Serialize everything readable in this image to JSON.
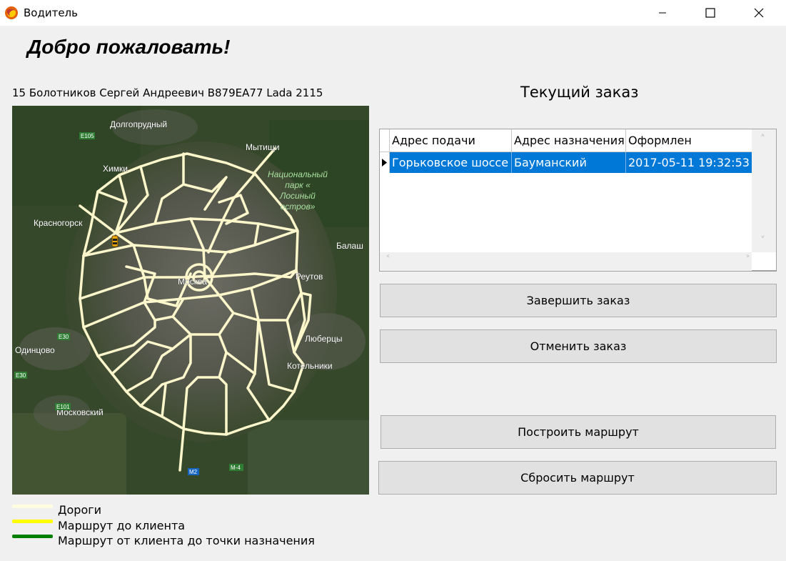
{
  "window": {
    "title": "Водитель"
  },
  "header": {
    "welcome": "Добро пожаловать!",
    "driver_info": "15 Болотников Сергей Андреевич В879ЕА77 Lada 2115"
  },
  "map": {
    "labels": {
      "dolgoprudny": "Долгопрудный",
      "mytishchi": "Мытищи",
      "khimki": "Химки",
      "park": [
        "Национальный",
        "парк «",
        "Лосиный",
        "остров»"
      ],
      "krasnogorsk": "Красногорск",
      "balash": "Балаш",
      "reutov": "Реутов",
      "moscow": "Москва",
      "lyubertsy": "Люберцы",
      "odintsovo": "Одинцово",
      "kotelniki": "Котельники",
      "moskovsky": "Московский",
      "e105": "E105",
      "e30a": "E30",
      "e30b": "E30",
      "e101": "E101",
      "m2": "M2",
      "m4": "M-4"
    }
  },
  "order": {
    "title": "Текущий заказ",
    "columns": [
      "Адрес подачи",
      "Адрес назначения",
      "Оформлен"
    ],
    "rows": [
      [
        "Горьковское шоссе",
        "Бауманский",
        "2017-05-11 19:32:53"
      ]
    ]
  },
  "buttons": {
    "finish": "Завершить заказ",
    "cancel": "Отменить заказ",
    "build_route": "Построить маршрут",
    "reset_route": "Сбросить маршрут"
  },
  "legend": [
    {
      "label": "Дороги",
      "color": "#fffde0"
    },
    {
      "label": "Маршрут до клиента",
      "color": "#ffff00"
    },
    {
      "label": "Маршрут от клиента до точки назначения",
      "color": "#008000"
    }
  ],
  "colors": {
    "selection": "#0078d7",
    "map_road": "#fff7cc"
  }
}
